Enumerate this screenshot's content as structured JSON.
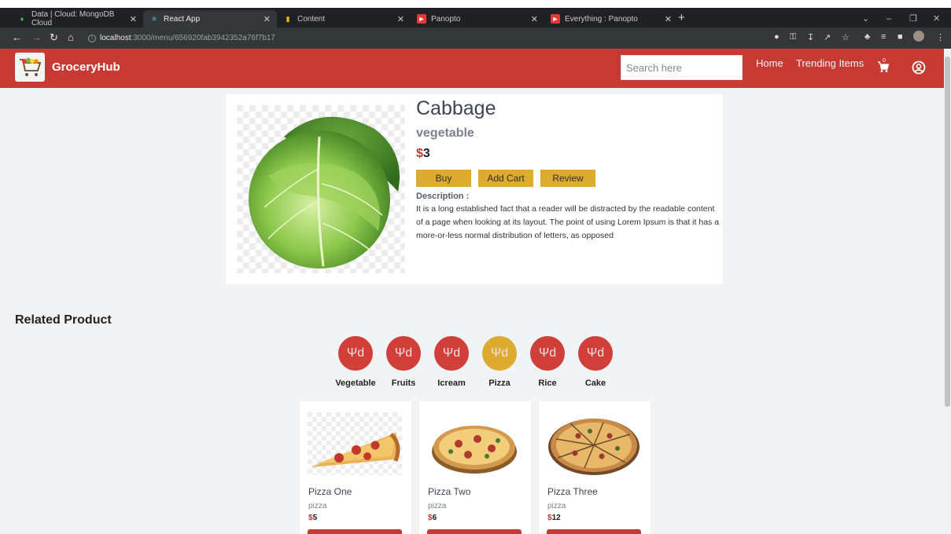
{
  "browser": {
    "tabs": [
      {
        "title": "Data | Cloud: MongoDB Cloud",
        "icon": "mongodb-leaf-icon"
      },
      {
        "title": "React App",
        "icon": "react-icon"
      },
      {
        "title": "Content",
        "icon": "chart-bars-icon"
      },
      {
        "title": "Panopto",
        "icon": "panopto-icon"
      },
      {
        "title": "Everything : Panopto",
        "icon": "panopto-icon"
      }
    ],
    "active_tab": 1,
    "url_host": "localhost",
    "url_path": ":3000/menu/656920fab3942352a76f7b17"
  },
  "navbar": {
    "brand": "GroceryHub",
    "search_placeholder": "Search here",
    "links": [
      "Home",
      "Trending Items"
    ],
    "cart_count": "0",
    "bg_color": "#c63a33"
  },
  "product": {
    "name": "Cabbage",
    "category": "vegetable",
    "currency": "$",
    "price": "3",
    "buttons": {
      "buy": "Buy",
      "add_cart": "Add Cart",
      "review": "Review"
    },
    "description_label": "Description :",
    "description": "It is a long established fact that a reader will be distracted by the readable content of a page when looking at its layout. The point of using Lorem Ipsum is that it has a more-or-less normal distribution of letters, as opposed"
  },
  "related": {
    "title": "Related Product",
    "categories": [
      {
        "label": "Vegetable",
        "icon": "fork-knife-icon"
      },
      {
        "label": "Fruits",
        "icon": "fork-knife-icon"
      },
      {
        "label": "Icream",
        "icon": "fork-knife-icon"
      },
      {
        "label": "Pizza",
        "icon": "fork-knife-icon",
        "selected": true
      },
      {
        "label": "Rice",
        "icon": "fork-knife-icon"
      },
      {
        "label": "Cake",
        "icon": "fork-knife-icon"
      }
    ],
    "items": [
      {
        "name": "Pizza One",
        "category": "pizza",
        "currency": "$",
        "price": "5"
      },
      {
        "name": "Pizza Two",
        "category": "pizza",
        "currency": "$",
        "price": "6"
      },
      {
        "name": "Pizza Three",
        "category": "pizza",
        "currency": "$",
        "price": "12"
      }
    ]
  },
  "colors": {
    "accent_red": "#c63a33",
    "accent_gold": "#dcab30",
    "page_bg": "#f1f3f5"
  }
}
